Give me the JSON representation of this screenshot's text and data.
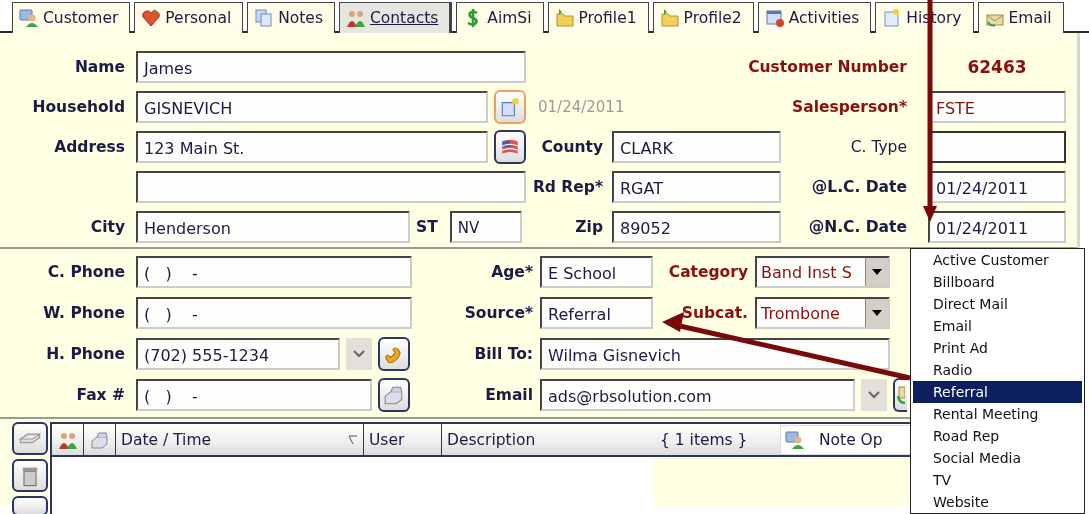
{
  "tabs": [
    {
      "label": "Customer",
      "selected": false
    },
    {
      "label": "Personal",
      "selected": false
    },
    {
      "label": "Notes",
      "selected": false
    },
    {
      "label": "Contacts",
      "selected": true
    },
    {
      "label": "AimSi",
      "selected": false
    },
    {
      "label": "Profile1",
      "selected": false
    },
    {
      "label": "Profile2",
      "selected": false
    },
    {
      "label": "Activities",
      "selected": false
    },
    {
      "label": "History",
      "selected": false
    },
    {
      "label": "Email",
      "selected": false
    }
  ],
  "address_section": {
    "name": {
      "label": "Name",
      "value": "James"
    },
    "household": {
      "label": "Household",
      "value": "GISNEVICH",
      "date": "01/24/2011"
    },
    "address": {
      "label": "Address",
      "value": "123 Main St."
    },
    "city": {
      "label": "City",
      "value": "Henderson"
    },
    "state": {
      "label": "ST",
      "value": "NV"
    },
    "county": {
      "label": "County",
      "value": "CLARK"
    },
    "rd_rep": {
      "label": "Rd Rep*",
      "value": "RGAT"
    },
    "zip": {
      "label": "Zip",
      "value": "89052"
    },
    "customer_number": {
      "label": "Customer Number",
      "value": "62463",
      "emphasized": true
    },
    "salesperson": {
      "label": "Salesperson*",
      "value": "FSTE",
      "emphasized": true
    },
    "c_type": {
      "label": "C. Type"
    },
    "lc_date": {
      "label": "@L.C. Date",
      "value": "01/24/2011"
    },
    "nc_date": {
      "label": "@N.C. Date",
      "value": "01/24/2011"
    }
  },
  "contact_section": {
    "c_phone": {
      "label": "C. Phone",
      "value": "(   )    -"
    },
    "w_phone": {
      "label": "W. Phone",
      "value": "(   )    -"
    },
    "h_phone": {
      "label": "H. Phone",
      "value": "(702) 555-1234"
    },
    "fax": {
      "label": "Fax  #",
      "value": "(   )    -"
    },
    "age": {
      "label": "Age*",
      "value": "E School"
    },
    "source": {
      "label": "Source*",
      "value": "Referral"
    },
    "bill_to": {
      "label": "Bill To:",
      "value": "Wilma Gisnevich"
    },
    "email": {
      "label": "Email",
      "value": "ads@rbsolution.com"
    },
    "category": {
      "label": "Category",
      "value": "Band Inst S",
      "emphasized": true
    },
    "subcat": {
      "label": "Subcat.",
      "value": "Trombone",
      "emphasized": true
    }
  },
  "notes_grid": {
    "columns": [
      {
        "label": "Date / Time"
      },
      {
        "label": "User"
      },
      {
        "label": "Description"
      }
    ],
    "count": "{ 1 items }",
    "note_button": "Note Op"
  },
  "source_dropdown": {
    "items": [
      {
        "label": "Active Customer",
        "selected": false
      },
      {
        "label": "Billboard",
        "selected": false
      },
      {
        "label": "Direct Mail",
        "selected": false
      },
      {
        "label": "Email",
        "selected": false
      },
      {
        "label": "Print Ad",
        "selected": false
      },
      {
        "label": "Radio",
        "selected": false
      },
      {
        "label": "Referral",
        "selected": true
      },
      {
        "label": "Rental Meeting",
        "selected": false
      },
      {
        "label": "Road Rep",
        "selected": false
      },
      {
        "label": "Social Media",
        "selected": false
      },
      {
        "label": "TV",
        "selected": false
      },
      {
        "label": "Website",
        "selected": false
      }
    ]
  }
}
